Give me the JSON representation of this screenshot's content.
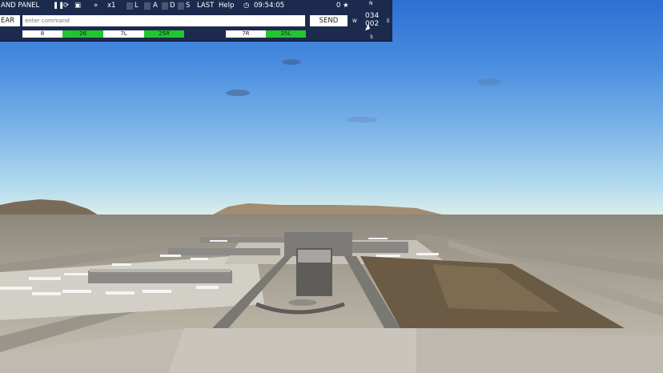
{
  "hud": {
    "panel_label": "AND PANEL",
    "speed": "x1",
    "toggles": [
      "L",
      "A",
      "D",
      "S"
    ],
    "last_label": "LAST",
    "help_label": "Help",
    "clock": "09:54:05",
    "score": "0",
    "clear_label": "EAR",
    "command_placeholder": "enter command",
    "send_label": "SEND",
    "runways": [
      {
        "label": "8",
        "active": false
      },
      {
        "label": "26",
        "active": true
      },
      {
        "label": "7L",
        "active": false
      },
      {
        "label": "25R",
        "active": true
      },
      {
        "label": "7R",
        "active": false
      },
      {
        "label": "25L",
        "active": true
      }
    ]
  },
  "compass": {
    "north": "N",
    "south": "S",
    "east": "E",
    "west": "W",
    "heading": "034",
    "heading2": "002"
  },
  "colors": {
    "hud_bg": "#1c2a4d",
    "runway_active": "#22c530",
    "sky_top": "#2d6fd3",
    "horizon": "#dff0e8"
  }
}
